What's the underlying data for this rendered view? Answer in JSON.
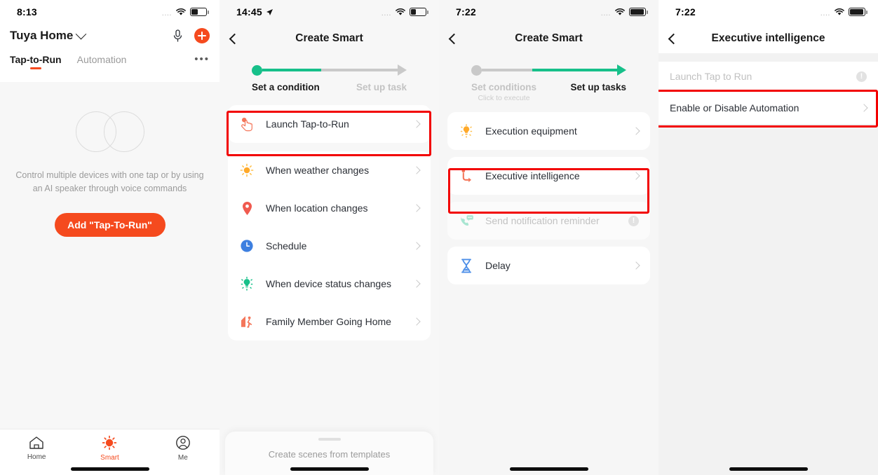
{
  "panel1": {
    "status": {
      "time": "8:13",
      "dots": "....",
      "wifi_icon": "wifi-icon",
      "battery_icon": "battery-icon",
      "battery_level": 45
    },
    "header": {
      "home_name": "Tuya Home",
      "chevron_icon": "chevron-down-icon",
      "mic_icon": "microphone-icon",
      "add_icon": "plus-icon"
    },
    "tabs": [
      {
        "label": "Tap-to-Run",
        "active": true
      },
      {
        "label": "Automation",
        "active": false
      }
    ],
    "more_icon": "more-options-icon",
    "empty_state": {
      "illustration": "venn-circles-icon",
      "text": "Control multiple devices with one tap or by using an AI speaker through voice commands",
      "button_label": "Add \"Tap-To-Run\""
    },
    "tabbar": [
      {
        "label": "Home",
        "icon": "home-icon",
        "active": false
      },
      {
        "label": "Smart",
        "icon": "sun-icon",
        "active": true
      },
      {
        "label": "Me",
        "icon": "person-icon",
        "active": false
      }
    ],
    "accent_color": "#f54a1e"
  },
  "panel2": {
    "status": {
      "time": "14:45",
      "dots": "....",
      "location_icon": "location-arrow-icon",
      "wifi_icon": "wifi-icon",
      "battery_icon": "battery-icon",
      "battery_level": 35
    },
    "nav": {
      "back_icon": "back-chevron-icon",
      "title": "Create Smart"
    },
    "stepper": {
      "steps": [
        {
          "label": "Set a condition",
          "active": true
        },
        {
          "label": "Set up task",
          "active": false
        }
      ],
      "active_color": "#17c08a",
      "inactive_color": "#c9c9c9"
    },
    "highlighted_row": {
      "label": "Launch Tap-to-Run",
      "icon": "tap-hand-icon",
      "chevron_icon": "chevron-right-icon"
    },
    "rows": [
      {
        "label": "When weather changes",
        "icon": "sun-weather-icon",
        "chevron_icon": "chevron-right-icon"
      },
      {
        "label": "When location changes",
        "icon": "location-pin-icon",
        "chevron_icon": "chevron-right-icon"
      },
      {
        "label": "Schedule",
        "icon": "clock-icon",
        "chevron_icon": "chevron-right-icon"
      },
      {
        "label": "When device status changes",
        "icon": "device-bulb-icon",
        "chevron_icon": "chevron-right-icon"
      },
      {
        "label": "Family Member Going Home",
        "icon": "family-member-icon",
        "chevron_icon": "chevron-right-icon"
      }
    ],
    "sheet": {
      "grab_icon": "drag-handle-icon",
      "text": "Create scenes from templates"
    },
    "highlight_color": "#f20000"
  },
  "panel3": {
    "status": {
      "time": "7:22",
      "dots": "....",
      "wifi_icon": "wifi-icon",
      "battery_icon": "battery-icon",
      "battery_level": 100
    },
    "nav": {
      "back_icon": "back-chevron-icon",
      "title": "Create Smart"
    },
    "stepper": {
      "steps": [
        {
          "label": "Set conditions",
          "sub": "Click to execute",
          "active": false
        },
        {
          "label": "Set up tasks",
          "sub": "",
          "active": true
        }
      ],
      "active_color": "#17c08a",
      "inactive_color": "#c9c9c9"
    },
    "rows": [
      {
        "label": "Execution equipment",
        "icon": "bulb-icon",
        "trailing": "chevron-right-icon",
        "disabled": false
      },
      {
        "label": "Executive intelligence",
        "icon": "branch-arrow-icon",
        "trailing": "chevron-right-icon",
        "disabled": false,
        "highlighted": true
      },
      {
        "label": "Send notification reminder",
        "icon": "phone-message-icon",
        "trailing": "info-icon",
        "disabled": true
      },
      {
        "label": "Delay",
        "icon": "hourglass-icon",
        "trailing": "chevron-right-icon",
        "disabled": false
      }
    ],
    "highlight_color": "#f20000"
  },
  "panel4": {
    "status": {
      "time": "7:22",
      "dots": "....",
      "wifi_icon": "wifi-icon",
      "battery_icon": "battery-icon",
      "battery_level": 100
    },
    "nav": {
      "back_icon": "back-chevron-icon",
      "title": "Executive intelligence"
    },
    "rows": [
      {
        "label": "Launch Tap to Run",
        "trailing": "info-icon",
        "disabled": true
      },
      {
        "label": "Enable or Disable Automation",
        "trailing": "chevron-right-icon",
        "disabled": false,
        "highlighted": true
      }
    ],
    "highlight_color": "#f20000"
  }
}
